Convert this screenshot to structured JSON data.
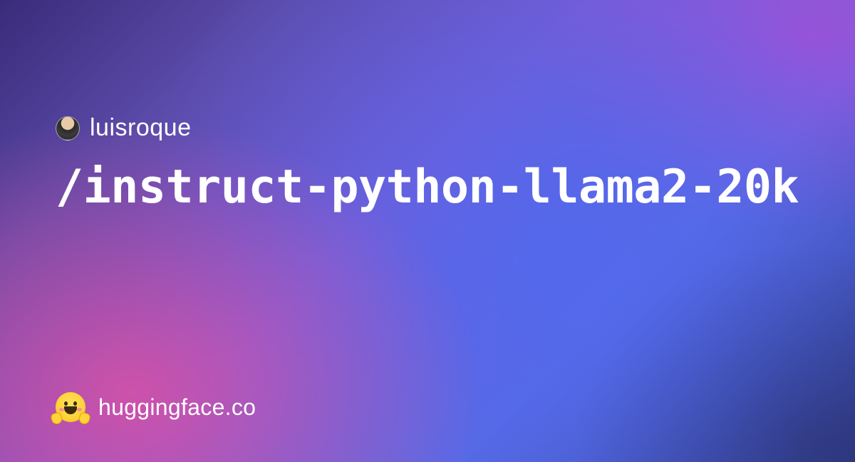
{
  "user": {
    "name": "luisroque"
  },
  "repo": {
    "path": "/instruct-python-llama2-20k"
  },
  "footer": {
    "domain": "huggingface.co"
  }
}
